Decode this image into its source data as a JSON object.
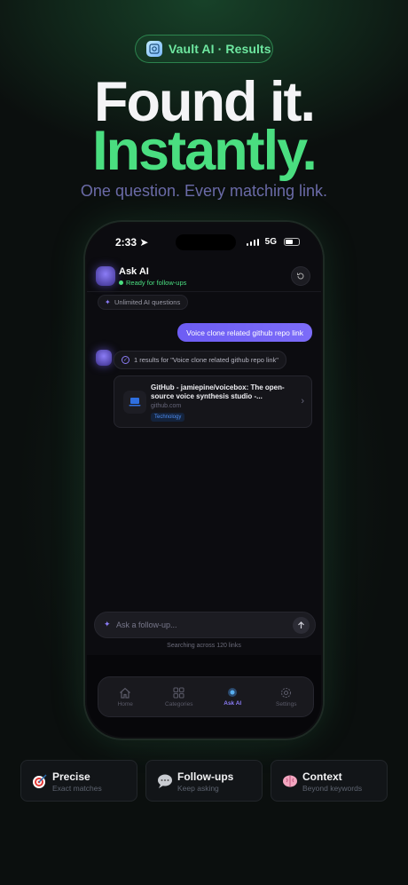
{
  "badge": {
    "label": "Vault AI · Results"
  },
  "headline": {
    "line1": "Found it.",
    "line2": "Instantly."
  },
  "subtitle": "One question. Every matching link.",
  "phone": {
    "status": {
      "time": "2:33",
      "network": "5G"
    },
    "header": {
      "title": "Ask AI",
      "status": "Ready for follow-ups"
    },
    "quota_chip": "Unlimited AI questions",
    "user_message": "Voice clone related github repo link",
    "results_summary": "1 results for \"Voice clone related github repo link\"",
    "result_card": {
      "title": "GitHub - jamiepine/voicebox: The open-source voice synthesis studio -...",
      "domain": "github.com",
      "tag": "Technology"
    },
    "composer": {
      "placeholder": "Ask a follow-up..."
    },
    "search_note": "Searching across 120 links",
    "tabs": [
      {
        "label": "Home",
        "icon": "home-icon"
      },
      {
        "label": "Categories",
        "icon": "grid-icon"
      },
      {
        "label": "Ask AI",
        "icon": "ai-orb-icon",
        "active": true
      },
      {
        "label": "Settings",
        "icon": "gear-icon"
      }
    ]
  },
  "features": [
    {
      "title": "Precise",
      "subtitle": "Exact matches",
      "icon": "target-icon"
    },
    {
      "title": "Follow-ups",
      "subtitle": "Keep asking",
      "icon": "speech-bubble-icon"
    },
    {
      "title": "Context",
      "subtitle": "Beyond keywords",
      "icon": "brain-icon"
    }
  ],
  "colors": {
    "accent_green": "#4ade80",
    "accent_purple": "#7c6cf8",
    "background": "#0b0f0e"
  }
}
